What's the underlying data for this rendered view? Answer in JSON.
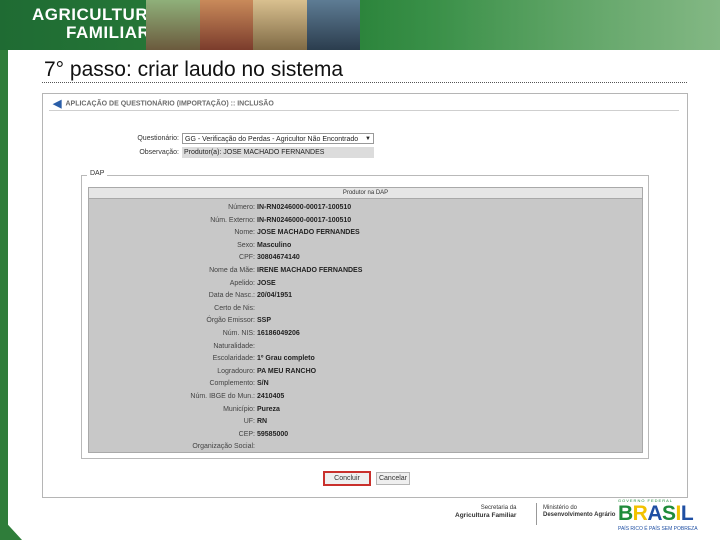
{
  "header": {
    "brand_line1": "AGRICULTURA",
    "brand_line2": "FAMILIAR"
  },
  "step_title": "7° passo: criar laudo no sistema",
  "app": {
    "title": "APLICAÇÃO DE QUESTIONÁRIO (IMPORTAÇÃO) :: INCLUSÃO",
    "questionario_label": "Questionário:",
    "questionario_value": "GG - Verificação do Perdas - Agricultor Não Encontrado",
    "observacao_label": "Observação:",
    "observacao_value": "Produtor(a): JOSE MACHADO FERNANDES",
    "dap": {
      "legend": "DAP",
      "header": "Produtor na DAP",
      "rows": [
        {
          "label": "Número:",
          "value": "IN-RN0246000-00017-100510"
        },
        {
          "label": "Núm. Externo:",
          "value": "IN-RN0246000-00017-100510"
        },
        {
          "label": "Nome:",
          "value": "JOSE MACHADO FERNANDES"
        },
        {
          "label": "Sexo:",
          "value": "Masculino"
        },
        {
          "label": "CPF:",
          "value": "30804674140"
        },
        {
          "label": "Nome da Mãe:",
          "value": "IRENE MACHADO FERNANDES"
        },
        {
          "label": "Apelido:",
          "value": "JOSE"
        },
        {
          "label": "Data de Nasc.:",
          "value": "20/04/1951"
        },
        {
          "label": "Certo de Nis:",
          "value": ""
        },
        {
          "label": "Órgão Emissor:",
          "value": "SSP"
        },
        {
          "label": "Núm. NIS:",
          "value": "16186049206"
        },
        {
          "label": "Naturalidade:",
          "value": ""
        },
        {
          "label": "Escolaridade:",
          "value": "1º Grau completo"
        },
        {
          "label": "Logradouro:",
          "value": "PA MEU RANCHO"
        },
        {
          "label": "Complemento:",
          "value": "S/N"
        },
        {
          "label": "Núm. IBGE do Mun.:",
          "value": "2410405"
        },
        {
          "label": "Município:",
          "value": "Pureza"
        },
        {
          "label": "UF:",
          "value": "RN"
        },
        {
          "label": "CEP:",
          "value": "59585000"
        },
        {
          "label": "Organização Social:",
          "value": ""
        }
      ]
    },
    "buttons": {
      "concluir": "Concluir",
      "cancelar": "Cancelar"
    }
  },
  "footer": {
    "sec_line1": "Secretaria da",
    "sec_line2": "Agricultura Familiar",
    "min_line1": "Ministério do",
    "min_line2": "Desenvolvimento Agrário",
    "gov_topline": "GOVERNO FEDERAL",
    "brasil_word": "BRASIL",
    "brasil_slogan": "PAÍS RICO É PAÍS SEM POBREZA"
  }
}
